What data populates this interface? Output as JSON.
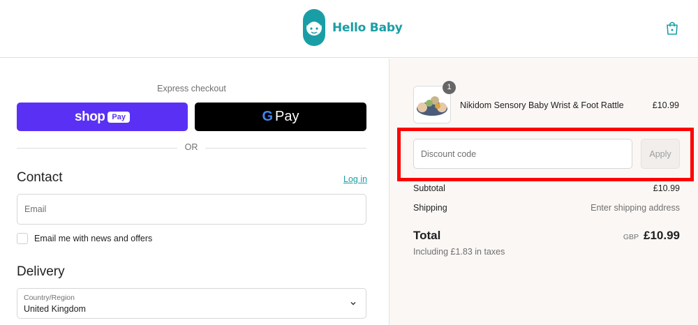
{
  "header": {
    "logo_text": "Hello Baby",
    "cart_icon": "shopping-bag-icon",
    "brand_color": "#1a9ea6"
  },
  "express": {
    "label": "Express checkout",
    "shop_pay": {
      "word": "shop",
      "badge": "Pay",
      "color": "#5a31f4"
    },
    "gpay": {
      "g": "G",
      "word": "Pay",
      "color": "#000000"
    },
    "divider_text": "OR"
  },
  "contact": {
    "title": "Contact",
    "login_link": "Log in",
    "email_placeholder": "Email",
    "newsletter_label": "Email me with news and offers",
    "newsletter_checked": false
  },
  "delivery": {
    "title": "Delivery",
    "country_label": "Country/Region",
    "country_value": "United Kingdom"
  },
  "order": {
    "product": {
      "name": "Nikidom Sensory Baby Wrist & Foot Rattle",
      "price": "£10.99",
      "quantity": "1"
    },
    "discount": {
      "placeholder": "Discount code",
      "apply_label": "Apply",
      "highlight_color": "#ff0000"
    },
    "subtotal": {
      "label": "Subtotal",
      "value": "£10.99"
    },
    "shipping": {
      "label": "Shipping",
      "value": "Enter shipping address"
    },
    "total": {
      "label": "Total",
      "currency": "GBP",
      "value": "£10.99"
    },
    "taxes_note": "Including £1.83 in taxes"
  }
}
